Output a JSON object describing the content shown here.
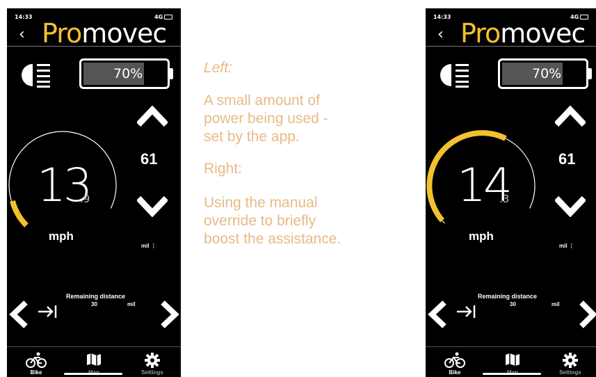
{
  "phones": {
    "left": {
      "status_time": "14:33",
      "status_signal": "4G",
      "back": "‹",
      "brand_prefix": "Pro",
      "brand_suffix": "movec",
      "battery_pct": "70%",
      "battery_level": 0.7,
      "speed_int": "13",
      "speed_dec": ".9",
      "speed_unit": "mph",
      "assist_level": "61",
      "dist_unit_small": "mil ⋮",
      "remaining_title": "Remaining distance",
      "remaining_value": "30",
      "remaining_unit": "mil",
      "nav": [
        "Bike",
        "Map",
        "Settings"
      ]
    },
    "right": {
      "status_time": "14:33",
      "status_signal": "4G",
      "back": "‹",
      "brand_prefix": "Pro",
      "brand_suffix": "movec",
      "battery_pct": "70%",
      "battery_level": 0.7,
      "speed_int": "14",
      "speed_dec": ".3",
      "speed_unit": "mph",
      "assist_level": "61",
      "dist_unit_small": "mil ⋮",
      "remaining_title": "Remaining distance",
      "remaining_value": "30",
      "remaining_unit": "mil",
      "nav": [
        "Bike",
        "Map",
        "Settings"
      ]
    }
  },
  "caption": {
    "left_heading": "Left:",
    "left_text": [
      "A small amount of",
      "power being used -",
      "set by the app."
    ],
    "right_heading": "Right:",
    "right_text": [
      "Using the manual",
      "override to briefly",
      "boost the assistance."
    ]
  },
  "colors": {
    "accent": "#f2c12e",
    "caption": "#e8ba85",
    "background": "#000000"
  },
  "icons": [
    "headlight-icon",
    "chevron-up-icon",
    "chevron-down-icon",
    "chevron-left-icon",
    "chevron-right-icon",
    "arrow-to-bar-icon",
    "bike-icon",
    "map-icon",
    "gear-icon"
  ]
}
